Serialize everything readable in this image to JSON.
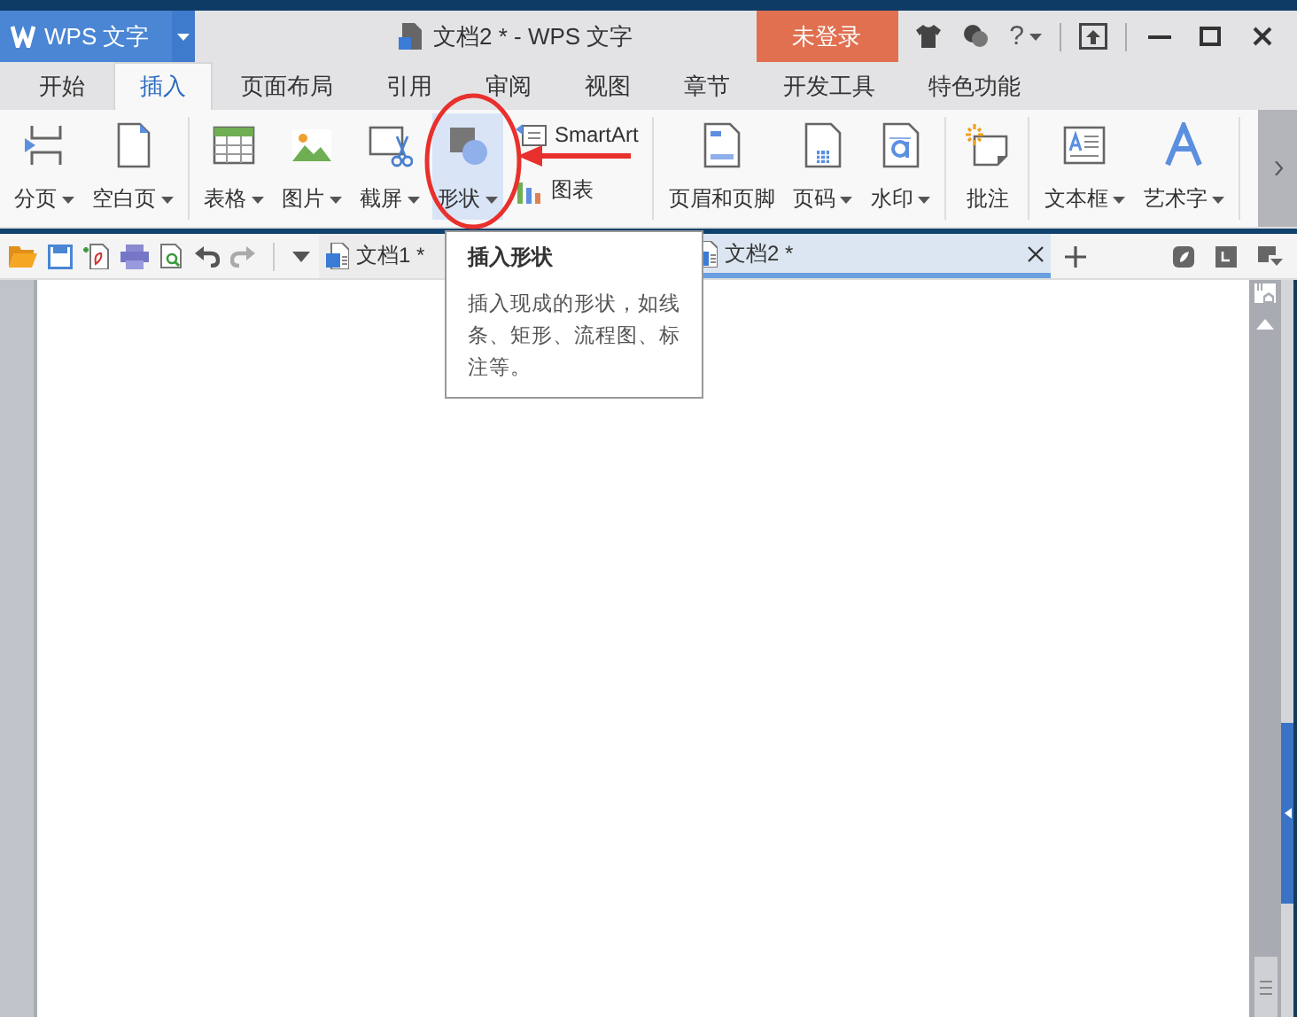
{
  "app_button": {
    "label": "WPS 文字"
  },
  "window": {
    "title": "文档2 * - WPS 文字"
  },
  "login_button": "未登录",
  "help_button": "?",
  "ribbon_tabs": [
    {
      "label": "开始",
      "selected": false
    },
    {
      "label": "插入",
      "selected": true
    },
    {
      "label": "页面布局",
      "selected": false
    },
    {
      "label": "引用",
      "selected": false
    },
    {
      "label": "审阅",
      "selected": false
    },
    {
      "label": "视图",
      "selected": false
    },
    {
      "label": "章节",
      "selected": false
    },
    {
      "label": "开发工具",
      "selected": false
    },
    {
      "label": "特色功能",
      "selected": false
    }
  ],
  "ribbon_groups": [
    [
      {
        "kind": "large",
        "label": "分页",
        "dropdown": true,
        "hovered": false
      },
      {
        "kind": "large",
        "label": "空白页",
        "dropdown": true,
        "hovered": false
      }
    ],
    [
      {
        "kind": "large",
        "label": "表格",
        "dropdown": true,
        "hovered": false
      },
      {
        "kind": "large",
        "label": "图片",
        "dropdown": true,
        "hovered": false
      },
      {
        "kind": "large",
        "label": "截屏",
        "dropdown": true,
        "hovered": false
      },
      {
        "kind": "large",
        "label": "形状",
        "dropdown": true,
        "hovered": true
      },
      {
        "kind": "stack",
        "items": [
          {
            "label": "SmartArt"
          },
          {
            "label": "图表"
          }
        ]
      }
    ],
    [
      {
        "kind": "large",
        "label": "页眉和页脚",
        "dropdown": false,
        "hovered": false
      },
      {
        "kind": "large",
        "label": "页码",
        "dropdown": true,
        "hovered": false
      },
      {
        "kind": "large",
        "label": "水印",
        "dropdown": true,
        "hovered": false
      }
    ],
    [
      {
        "kind": "large",
        "label": "批注",
        "dropdown": false,
        "hovered": false
      }
    ],
    [
      {
        "kind": "large",
        "label": "文本框",
        "dropdown": true,
        "hovered": false
      },
      {
        "kind": "large",
        "label": "艺术字",
        "dropdown": true,
        "hovered": false
      }
    ]
  ],
  "document_tabs": [
    {
      "title": "文档1 *",
      "selected": false
    },
    {
      "title": "文档2 *",
      "selected": true
    }
  ],
  "tooltip": {
    "title": "插入形状",
    "text": "插入现成的形状，如线条、矩形、流程图、标注等。"
  }
}
